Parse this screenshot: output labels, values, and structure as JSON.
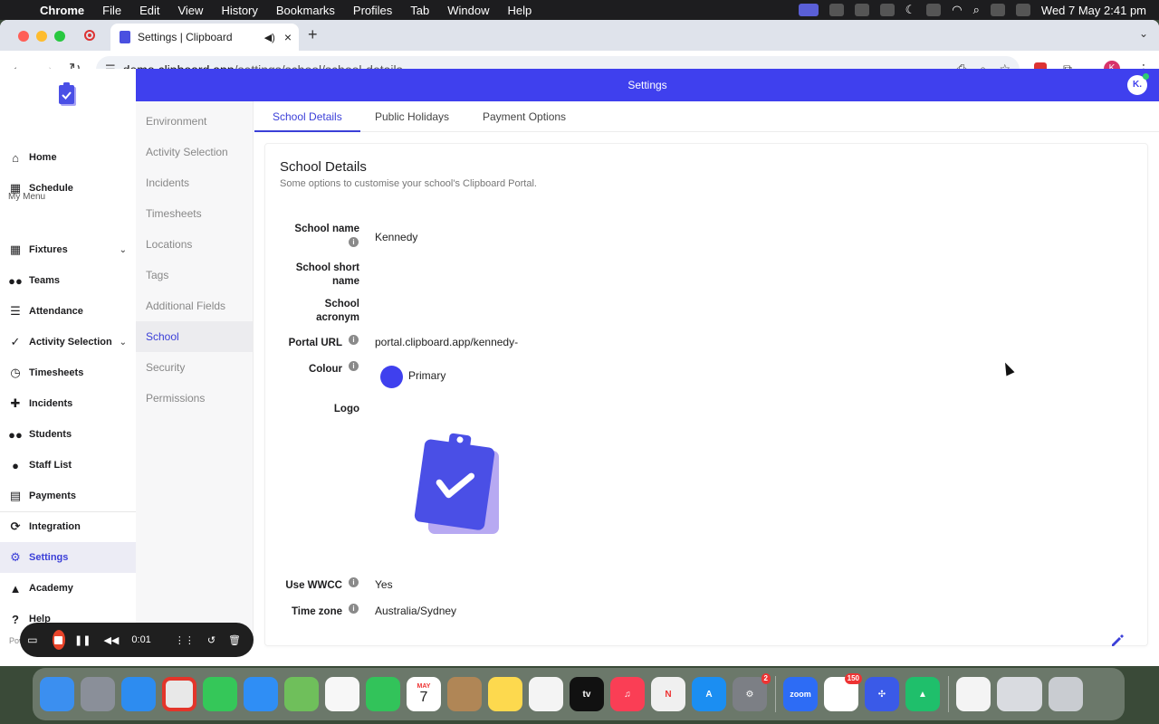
{
  "menubar": {
    "app_name": "Chrome",
    "items": [
      "File",
      "Edit",
      "View",
      "History",
      "Bookmarks",
      "Profiles",
      "Tab",
      "Window",
      "Help"
    ],
    "clock": "Wed 7 May  2:41 pm"
  },
  "browser": {
    "tab_title": "Settings | Clipboard",
    "url_host": "demo.clipboard.app",
    "url_path": "/settings/school/school-details",
    "extension_badge": "5",
    "profile_initial": "K"
  },
  "app": {
    "header_title": "Settings",
    "user_initial": "K.",
    "my_menu_label": "My Menu",
    "nav_items": [
      {
        "label": "Home"
      },
      {
        "label": "Schedule"
      },
      {
        "label": "Fixtures"
      },
      {
        "label": "Teams"
      },
      {
        "label": "Attendance"
      },
      {
        "label": "Activity Selection"
      },
      {
        "label": "Timesheets"
      },
      {
        "label": "Incidents"
      },
      {
        "label": "Students"
      },
      {
        "label": "Staff List"
      },
      {
        "label": "Payments"
      },
      {
        "label": "Integration"
      },
      {
        "label": "Settings"
      },
      {
        "label": "Academy"
      },
      {
        "label": "Help"
      }
    ],
    "powered_by": "Powered by",
    "settings_menu": [
      "Environment",
      "Activity Selection",
      "Incidents",
      "Timesheets",
      "Locations",
      "Tags",
      "Additional Fields",
      "School",
      "Security",
      "Permissions"
    ],
    "tabs": [
      "School Details",
      "Public Holidays",
      "Payment Options"
    ],
    "section_title": "School Details",
    "section_subtitle": "Some options to customise your school's Clipboard Portal.",
    "fields": {
      "school_name_label": "School name",
      "school_name_value": "Kennedy",
      "short_name_label": "School short name",
      "acronym_label": "School acronym",
      "portal_url_label": "Portal URL",
      "portal_url_value": "portal.clipboard.app/kennedy-",
      "colour_label": "Colour",
      "colour_value": "Primary",
      "logo_label": "Logo",
      "wwcc_label": "Use WWCC",
      "wwcc_value": "Yes",
      "timezone_label": "Time zone",
      "timezone_value": "Australia/Sydney"
    },
    "info_glyph": "i",
    "colors": {
      "brand": "#3f40ee",
      "active_nav": "#3b3fd8"
    }
  },
  "recorder": {
    "elapsed": "0:01"
  },
  "dock": {
    "calendar_month": "MAY",
    "calendar_day": "7",
    "settings_badge": "2",
    "slack_badge": "150",
    "zoom_label": "zoom",
    "tv_label": "tv"
  }
}
